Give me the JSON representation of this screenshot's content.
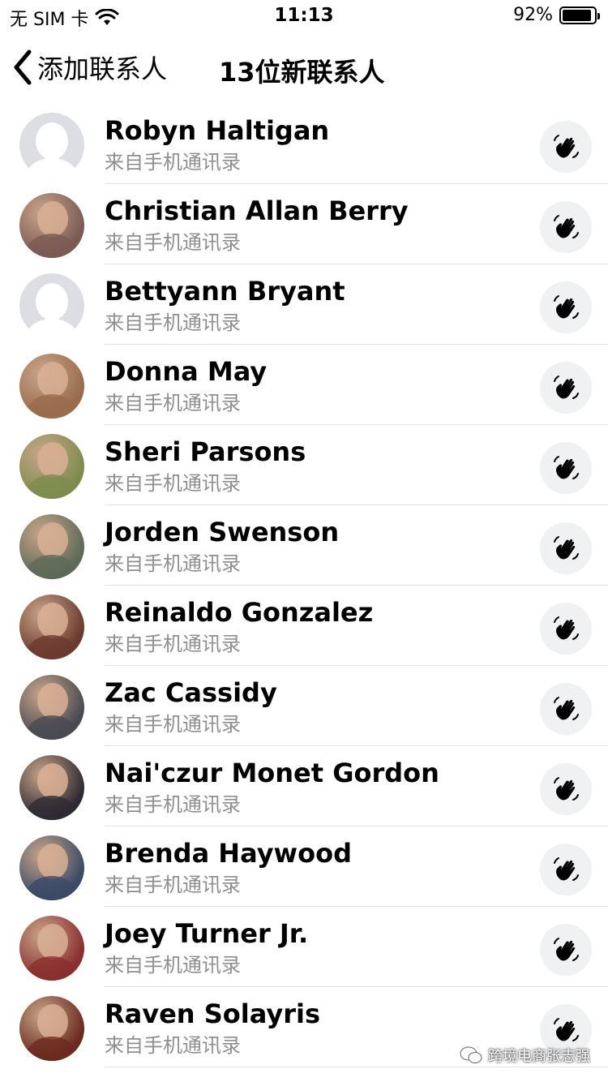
{
  "status_bar": {
    "carrier": "无 SIM 卡",
    "time": "11:13",
    "battery_percent_label": "92%",
    "battery_level": 0.92
  },
  "nav": {
    "back_label": "添加联系人",
    "title": "13位新联系人"
  },
  "contacts": [
    {
      "name": "Robyn Haltigan",
      "source": "来自手机通讯录",
      "avatar": "placeholder"
    },
    {
      "name": "Christian Allan Berry",
      "source": "来自手机通讯录",
      "avatar": "photo",
      "tone": "#7a5a55"
    },
    {
      "name": "Bettyann Bryant",
      "source": "来自手机通讯录",
      "avatar": "placeholder"
    },
    {
      "name": "Donna May",
      "source": "来自手机通讯录",
      "avatar": "photo",
      "tone": "#9a6b4c"
    },
    {
      "name": "Sheri Parsons",
      "source": "来自手机通讯录",
      "avatar": "photo",
      "tone": "#7d8c4e"
    },
    {
      "name": "Jorden Swenson",
      "source": "来自手机通讯录",
      "avatar": "photo",
      "tone": "#5e6a58"
    },
    {
      "name": "Reinaldo Gonzalez",
      "source": "来自手机通讯录",
      "avatar": "photo",
      "tone": "#6b3a2e"
    },
    {
      "name": "Zac Cassidy",
      "source": "来自手机通讯录",
      "avatar": "photo",
      "tone": "#4a4a52"
    },
    {
      "name": "Nai'czur Monet Gordon",
      "source": "来自手机通讯录",
      "avatar": "photo",
      "tone": "#2e2a33"
    },
    {
      "name": "Brenda Haywood",
      "source": "来自手机通讯录",
      "avatar": "photo",
      "tone": "#3b4a66"
    },
    {
      "name": "Joey Turner Jr.",
      "source": "来自手机通讯录",
      "avatar": "photo",
      "tone": "#8a2f2f"
    },
    {
      "name": "Raven Solayris",
      "source": "来自手机通讯录",
      "avatar": "photo",
      "tone": "#6b2a1e"
    }
  ],
  "watermark": {
    "text": "跨境电商张志强"
  },
  "colors": {
    "secondary_text": "#8e8e93",
    "wave_button_bg": "#f0f1f3",
    "placeholder_avatar": "#dcdee3"
  },
  "icons": {
    "back": "chevron-left-icon",
    "wave": "waving-hand-icon",
    "wifi": "wifi-icon",
    "battery": "battery-icon"
  }
}
